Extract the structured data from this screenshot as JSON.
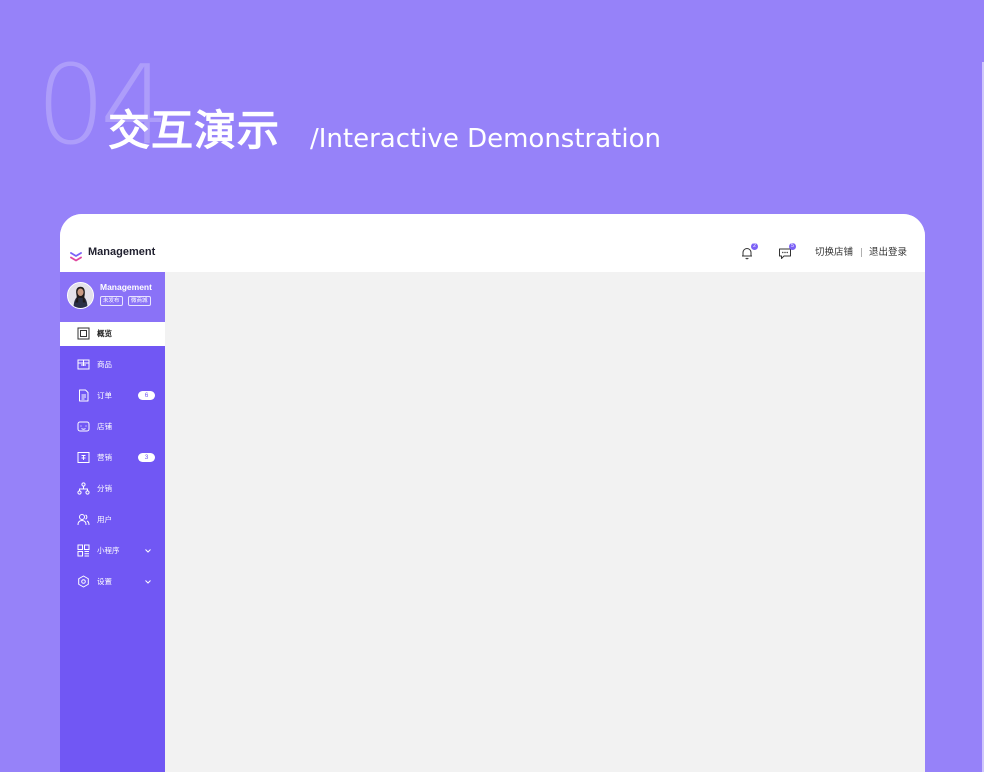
{
  "slide": {
    "number": "04",
    "title": "交互演示",
    "subtitle": "/Interactive Demonstration"
  },
  "colors": {
    "background": "#9682F9",
    "sidebar": "#7157F4",
    "profile_bg": "#8A72F7",
    "content_bg": "#f2f2f2",
    "accent": "#7B61F6"
  },
  "app": {
    "brand": "Management",
    "topbar": {
      "bell_icon": "bell-icon",
      "bell_badge": "2",
      "message_icon": "message-icon",
      "message_badge": "5",
      "switch_store": "切换店铺",
      "separator": "|",
      "logout": "退出登录"
    },
    "profile": {
      "name": "Management",
      "tags": [
        "未发布",
        "微商城"
      ]
    },
    "nav": [
      {
        "label": "概览",
        "icon": "overview-icon",
        "active": true
      },
      {
        "label": "商品",
        "icon": "product-icon"
      },
      {
        "label": "订单",
        "icon": "order-icon",
        "badge": "6"
      },
      {
        "label": "店铺",
        "icon": "store-icon"
      },
      {
        "label": "营销",
        "icon": "marketing-icon",
        "badge": "3"
      },
      {
        "label": "分销",
        "icon": "distribution-icon"
      },
      {
        "label": "用户",
        "icon": "user-icon"
      },
      {
        "label": "小程序",
        "icon": "miniprogram-icon",
        "expandable": true
      },
      {
        "label": "设置",
        "icon": "settings-icon",
        "expandable": true
      }
    ]
  }
}
